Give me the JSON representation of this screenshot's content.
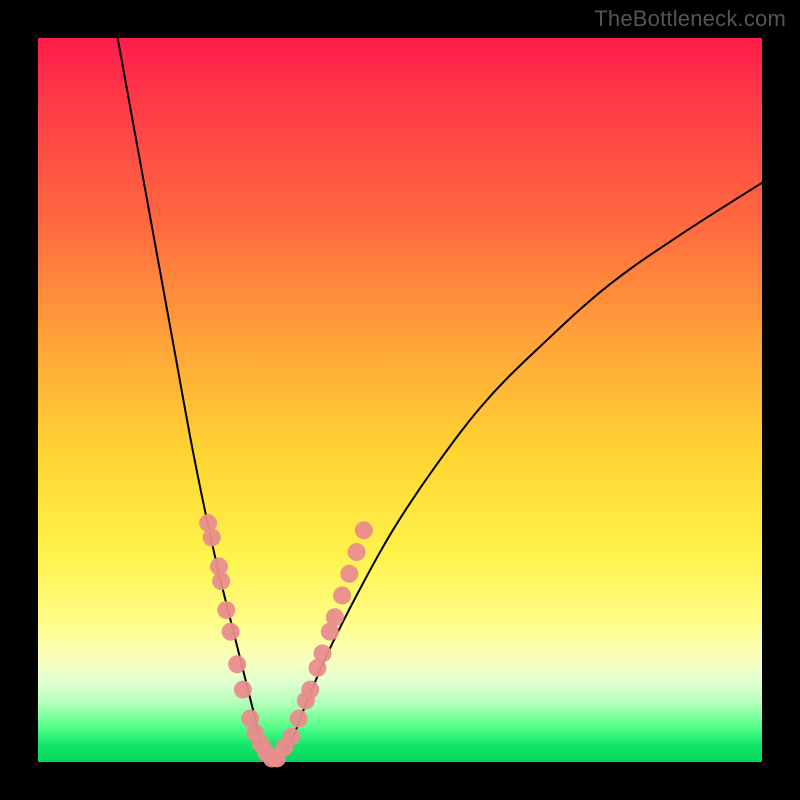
{
  "watermark": {
    "text": "TheBottleneck.com"
  },
  "gradient": {
    "top": "#ff1b4a",
    "mid_orange": "#ffa439",
    "mid_yellow": "#fff24a",
    "bottom": "#00d45a"
  },
  "chart_data": {
    "type": "line",
    "title": "",
    "xlabel": "",
    "ylabel": "",
    "xlim": [
      0,
      100
    ],
    "ylim": [
      0,
      100
    ],
    "grid": false,
    "legend": false,
    "notes": "V-shaped bottleneck curve: two black curves descend from high mismatch (red region) to a minimum near x≈32 at y≈0 (green region). Salmon-colored marker clusters sit along both curve branches in the lower third, densest near the minimum. Values are read approximately from pixel positions; axes are unlabeled.",
    "series": [
      {
        "name": "left-branch",
        "color": "#000000",
        "x": [
          11,
          13,
          15,
          17,
          19,
          21,
          23,
          25,
          27,
          29,
          30,
          31,
          32
        ],
        "y": [
          100,
          89,
          78,
          67,
          56,
          45,
          35,
          26,
          18,
          10,
          6,
          2,
          0
        ]
      },
      {
        "name": "right-branch",
        "color": "#000000",
        "x": [
          33,
          35,
          37,
          40,
          44,
          49,
          55,
          62,
          70,
          79,
          89,
          100
        ],
        "y": [
          0,
          3,
          8,
          15,
          23,
          32,
          41,
          50,
          58,
          66,
          73,
          80
        ]
      }
    ],
    "markers": [
      {
        "name": "left-branch-dots",
        "color": "#e98d8d",
        "x": [
          23.5,
          24.0,
          25.0,
          25.3,
          26.0,
          26.6,
          27.5,
          28.3,
          29.3,
          30.0,
          30.8,
          31.5,
          32.3
        ],
        "y": [
          33.0,
          31.0,
          27.0,
          25.0,
          21.0,
          18.0,
          13.5,
          10.0,
          6.0,
          4.0,
          2.5,
          1.3,
          0.5
        ]
      },
      {
        "name": "right-branch-dots",
        "color": "#e98d8d",
        "x": [
          33.0,
          34.0,
          35.0,
          36.0,
          37.0,
          37.6,
          38.6,
          39.3,
          40.3,
          41.0,
          42.0,
          43.0,
          44.0,
          45.0
        ],
        "y": [
          0.5,
          2.0,
          3.5,
          6.0,
          8.5,
          10.0,
          13.0,
          15.0,
          18.0,
          20.0,
          23.0,
          26.0,
          29.0,
          32.0
        ]
      }
    ]
  }
}
